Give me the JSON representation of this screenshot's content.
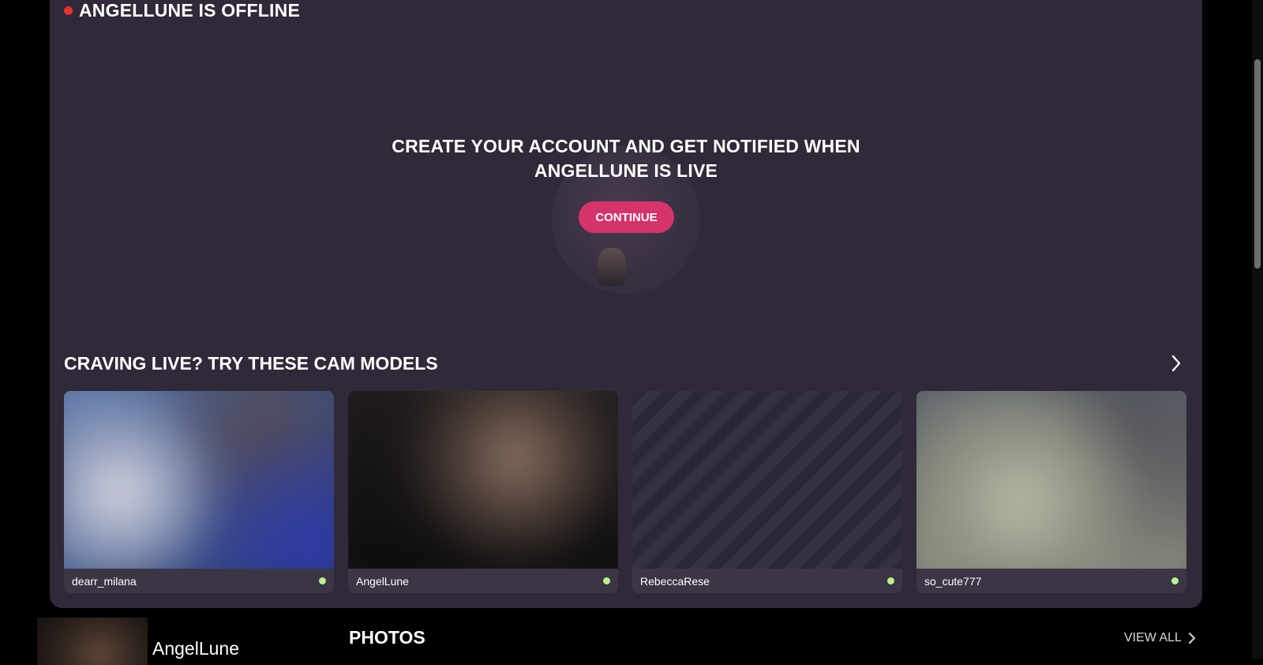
{
  "status": {
    "text": "ANGELLUNE IS OFFLINE",
    "color": "#e8322d"
  },
  "offline_prompt": {
    "line1": "CREATE YOUR ACCOUNT AND GET NOTIFIED WHEN",
    "line2": "ANGELLUNE IS LIVE",
    "button": "CONTINUE",
    "button_color": "#d6336c"
  },
  "recommendations": {
    "title": "CRAVING LIVE? TRY THESE CAM MODELS",
    "models": [
      {
        "name": "dearr_milana",
        "online": true
      },
      {
        "name": "AngelLune",
        "online": true
      },
      {
        "name": "RebeccaRese",
        "online": true
      },
      {
        "name": "so_cute777",
        "online": true
      }
    ],
    "online_color": "#b9f28a"
  },
  "profile": {
    "name": "AngelLune"
  },
  "photos": {
    "title": "PHOTOS",
    "view_all": "VIEW ALL"
  }
}
